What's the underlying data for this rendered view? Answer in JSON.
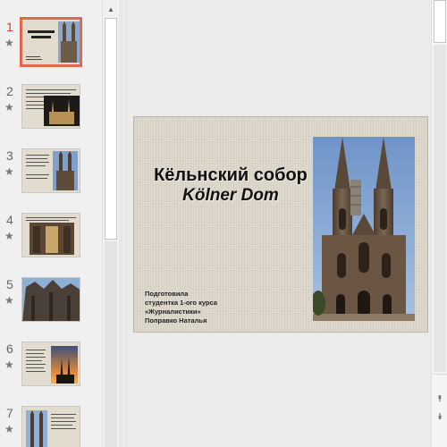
{
  "thumbnails": [
    {
      "number": "1",
      "active": true
    },
    {
      "number": "2",
      "active": false
    },
    {
      "number": "3",
      "active": false
    },
    {
      "number": "4",
      "active": false
    },
    {
      "number": "5",
      "active": false
    },
    {
      "number": "6",
      "active": false
    },
    {
      "number": "7",
      "active": false
    }
  ],
  "thumbnail_icons": {
    "star": "star-icon"
  },
  "slide": {
    "title": "Кёльнский собор",
    "subtitle": "Kölner Dom",
    "author_lines": [
      "Подготовила",
      "студентка 1-ого курса",
      "«Журналистики»",
      "Поправко Наталья"
    ]
  },
  "scrollbars": {
    "up": "▲",
    "down": "▼",
    "prev_slide": "⯭",
    "next_slide": "⯯"
  },
  "colors": {
    "active_thumb": "#e0694c",
    "slide_bg": "#ddd7cb"
  }
}
